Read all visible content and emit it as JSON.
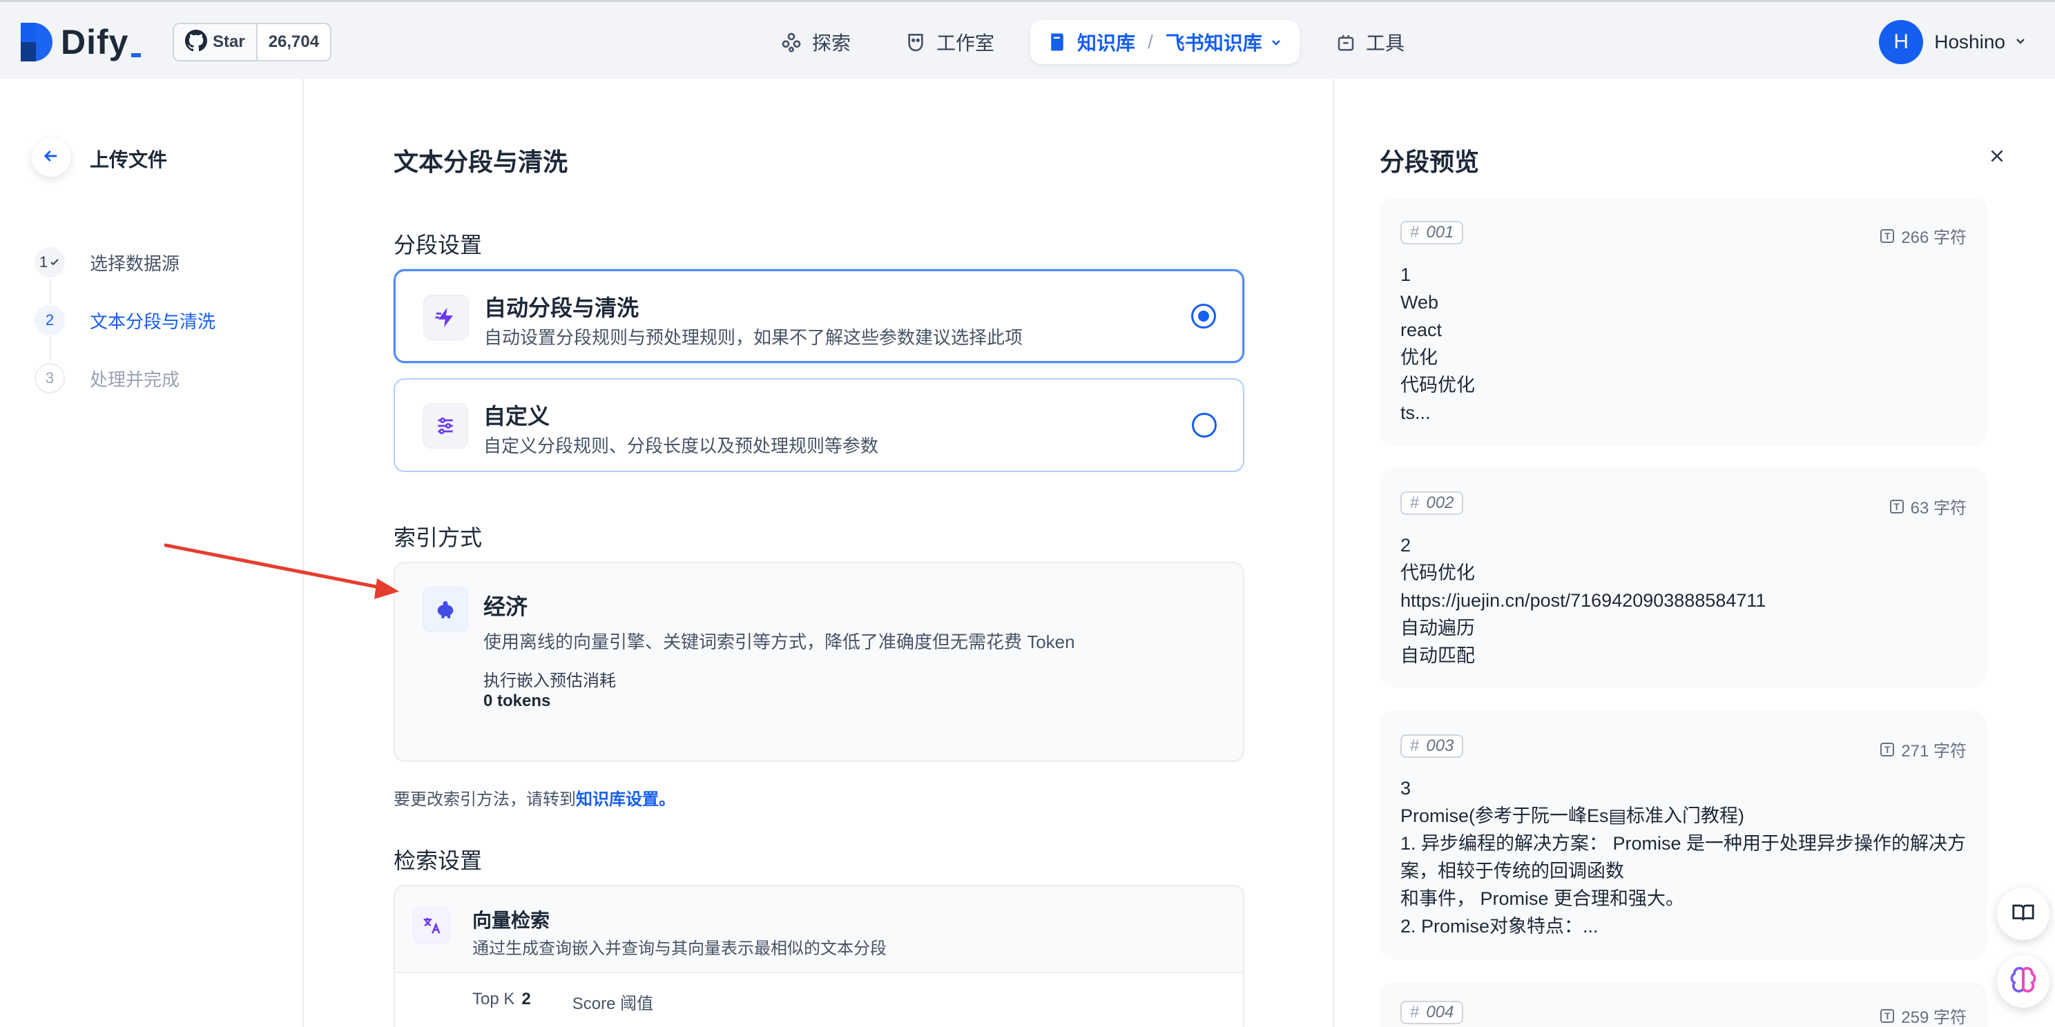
{
  "header": {
    "logo_text": "Dify",
    "github": {
      "star_label": "Star",
      "count": "26,704"
    },
    "nav": [
      {
        "label": "探索",
        "icon": "explore-icon"
      },
      {
        "label": "工作室",
        "icon": "studio-icon"
      },
      {
        "label": "知识库",
        "icon": "book-icon",
        "sub": "飞书知识库",
        "separator": "/"
      },
      {
        "label": "工具",
        "icon": "tools-icon"
      }
    ],
    "user": {
      "initial": "H",
      "name": "Hoshino"
    }
  },
  "sidebar": {
    "title": "上传文件",
    "steps": [
      {
        "num": "1",
        "label": "选择数据源",
        "state": "done"
      },
      {
        "num": "2",
        "label": "文本分段与清洗",
        "state": "active"
      },
      {
        "num": "3",
        "label": "处理并完成",
        "state": "pending"
      }
    ]
  },
  "main": {
    "title": "文本分段与清洗",
    "segment_settings": {
      "heading": "分段设置",
      "options": [
        {
          "title": "自动分段与清洗",
          "desc": "自动设置分段规则与预处理规则，如果不了解这些参数建议选择此项",
          "selected": true
        },
        {
          "title": "自定义",
          "desc": "自定义分段规则、分段长度以及预处理规则等参数",
          "selected": false
        }
      ]
    },
    "index_mode": {
      "heading": "索引方式",
      "title": "经济",
      "desc": "使用离线的向量引擎、关键词索引等方式，降低了准确度但无需花费 Token",
      "cost_label": "执行嵌入预估消耗",
      "cost_value": "0 tokens"
    },
    "note": {
      "text": "要更改索引方法，请转到",
      "link": "知识库设置。"
    },
    "retrieval": {
      "heading": "检索设置",
      "title": "向量检索",
      "desc": "通过生成查询嵌入并查询与其向量表示最相似的文本分段",
      "topk_label": "Top K",
      "topk_value": "2",
      "score_label": "Score 阈值"
    }
  },
  "preview": {
    "title": "分段预览",
    "segments": [
      {
        "id": "001",
        "count": "266 字符",
        "lines": [
          "1",
          "Web",
          "react",
          "优化",
          "代码优化",
          "ts..."
        ]
      },
      {
        "id": "002",
        "count": "63 字符",
        "lines": [
          "2",
          "代码优化",
          "https://juejin.cn/post/7169420903888584711",
          "自动遍历",
          "自动匹配"
        ]
      },
      {
        "id": "003",
        "count": "271 字符",
        "lines": [
          "3",
          "Promise(参考于阮一峰Es▤标准入门教程)",
          "1. 异步编程的解决方案： Promise 是一种用于处理异步操作的解决方",
          "案，相较于传统的回调函数",
          "和事件， Promise 更合理和强大。",
          "2. Promise对象特点：..."
        ]
      },
      {
        "id": "004",
        "count": "259 字符",
        "lines": []
      }
    ]
  },
  "colors": {
    "accent": "#155eef",
    "annotation_arrow": "#e53e2f"
  }
}
